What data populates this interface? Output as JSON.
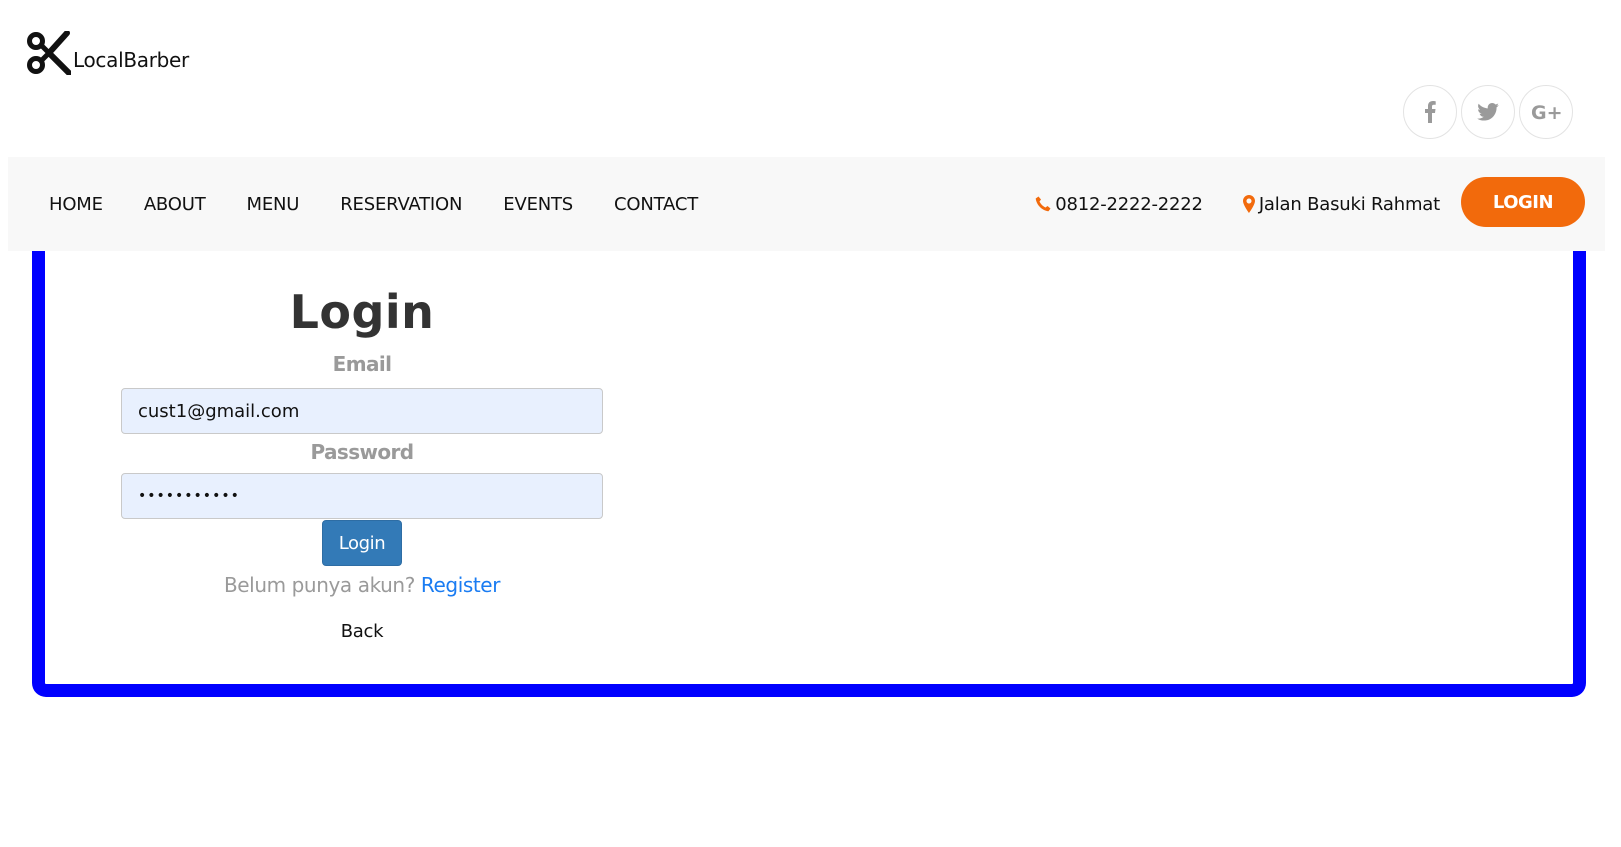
{
  "brand": {
    "name": "LocalBarber",
    "logo_icon": "scissors-icon"
  },
  "social": [
    {
      "name": "facebook",
      "icon": "facebook-icon"
    },
    {
      "name": "twitter",
      "icon": "twitter-icon"
    },
    {
      "name": "google-plus",
      "icon": "google-plus-icon"
    }
  ],
  "nav": {
    "items": [
      "HOME",
      "ABOUT",
      "MENU",
      "RESERVATION",
      "EVENTS",
      "CONTACT"
    ],
    "phone": "0812-2222-2222",
    "address": "Jalan Basuki Rahmat",
    "login_label": "LOGIN"
  },
  "login": {
    "title": "Login",
    "email_label": "Email",
    "email_value": "cust1@gmail.com",
    "password_label": "Password",
    "password_value": "•••••••••••",
    "submit_label": "Login",
    "register_prompt": "Belum punya akun?",
    "register_link": "Register",
    "back_label": "Back"
  },
  "colors": {
    "accent_orange": "#f26a0c",
    "primary_blue": "#337ab7",
    "card_border": "#0000ff",
    "link_blue": "#1a7cf2",
    "input_bg": "#e8f0fe"
  }
}
